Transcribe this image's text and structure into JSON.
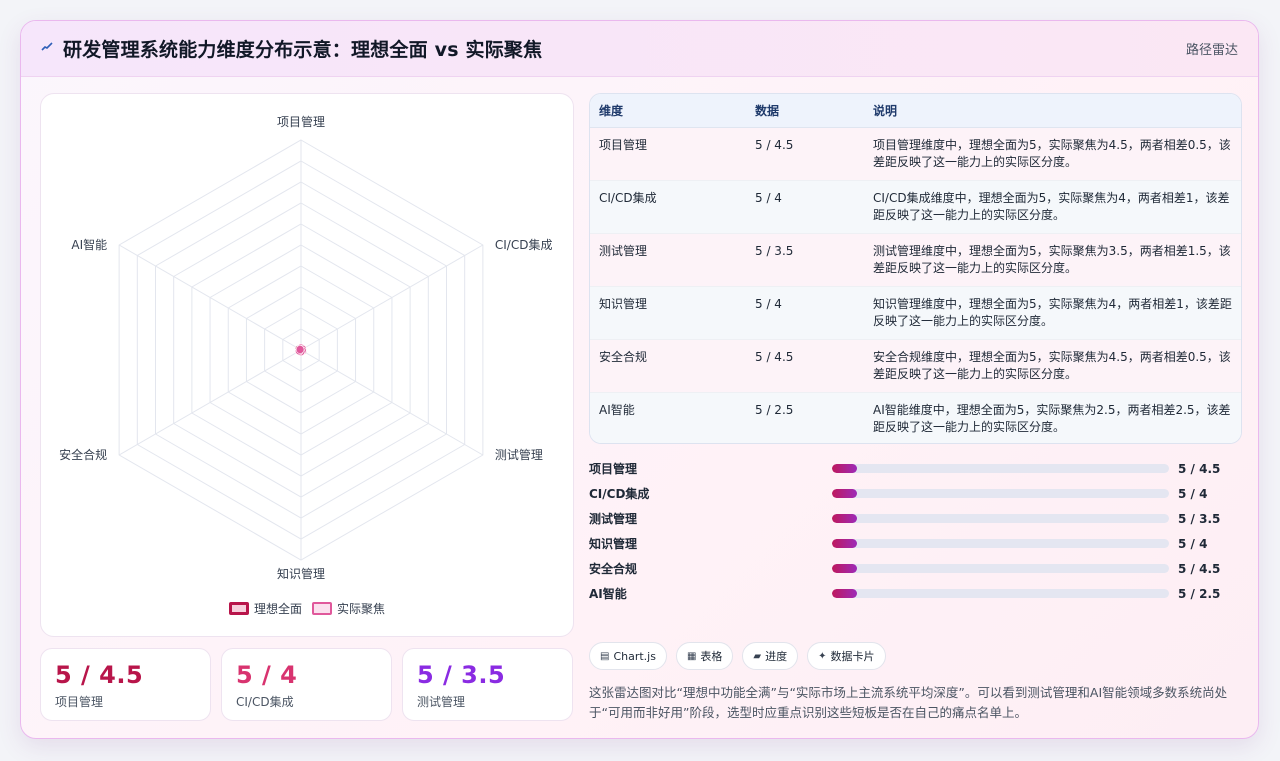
{
  "header": {
    "icon": "chart-line-icon",
    "title": "研发管理系统能力维度分布示意：理想全面 vs 实际聚焦",
    "right_label": "路径雷达"
  },
  "colors": {
    "ideal": "#b8154a",
    "actual": "#e0589b",
    "stat1": "#b8154a",
    "stat2": "#d8336f",
    "stat3": "#8a2be2"
  },
  "chart_data": {
    "type": "radar",
    "categories": [
      "项目管理",
      "CI/CD集成",
      "测试管理",
      "知识管理",
      "安全合规",
      "AI智能"
    ],
    "series": [
      {
        "name": "理想全面",
        "values": [
          5,
          5,
          5,
          5,
          5,
          5
        ]
      },
      {
        "name": "实际聚焦",
        "values": [
          4.5,
          4,
          3.5,
          4,
          4.5,
          2.5
        ]
      }
    ],
    "rlim": [
      0,
      500
    ],
    "ring_count": 10,
    "legend_position": "bottom"
  },
  "stats": [
    {
      "value": "5 / 4.5",
      "label": "项目管理"
    },
    {
      "value": "5 / 4",
      "label": "CI/CD集成"
    },
    {
      "value": "5 / 3.5",
      "label": "测试管理"
    }
  ],
  "table": {
    "headers": [
      "维度",
      "数据",
      "说明"
    ],
    "rows": [
      {
        "dim": "项目管理",
        "data": "5 / 4.5",
        "desc": "项目管理维度中，理想全面为5，实际聚焦为4.5，两者相差0.5，该差距反映了这一能力上的实际区分度。"
      },
      {
        "dim": "CI/CD集成",
        "data": "5 / 4",
        "desc": "CI/CD集成维度中，理想全面为5，实际聚焦为4，两者相差1，该差距反映了这一能力上的实际区分度。"
      },
      {
        "dim": "测试管理",
        "data": "5 / 3.5",
        "desc": "测试管理维度中，理想全面为5，实际聚焦为3.5，两者相差1.5，该差距反映了这一能力上的实际区分度。"
      },
      {
        "dim": "知识管理",
        "data": "5 / 4",
        "desc": "知识管理维度中，理想全面为5，实际聚焦为4，两者相差1，该差距反映了这一能力上的实际区分度。"
      },
      {
        "dim": "安全合规",
        "data": "5 / 4.5",
        "desc": "安全合规维度中，理想全面为5，实际聚焦为4.5，两者相差0.5，该差距反映了这一能力上的实际区分度。"
      },
      {
        "dim": "AI智能",
        "data": "5 / 2.5",
        "desc": "AI智能维度中，理想全面为5，实际聚焦为2.5，两者相差2.5，该差距反映了这一能力上的实际区分度。"
      }
    ]
  },
  "bars": [
    {
      "label": "项目管理",
      "value": "5 / 4.5",
      "fraction": 0.075
    },
    {
      "label": "CI/CD集成",
      "value": "5 / 4",
      "fraction": 0.075
    },
    {
      "label": "测试管理",
      "value": "5 / 3.5",
      "fraction": 0.075
    },
    {
      "label": "知识管理",
      "value": "5 / 4",
      "fraction": 0.075
    },
    {
      "label": "安全合规",
      "value": "5 / 4.5",
      "fraction": 0.075
    },
    {
      "label": "AI智能",
      "value": "5 / 2.5",
      "fraction": 0.075
    }
  ],
  "chips": [
    {
      "icon": "chart-icon",
      "glyph": "▤",
      "label": "Chart.js"
    },
    {
      "icon": "table-icon",
      "glyph": "▦",
      "label": "表格"
    },
    {
      "icon": "progress-icon",
      "glyph": "▰",
      "label": "进度"
    },
    {
      "icon": "card-icon",
      "glyph": "✦",
      "label": "数据卡片"
    }
  ],
  "note": "这张雷达图对比“理想中功能全满”与“实际市场上主流系统平均深度”。可以看到测试管理和AI智能领域多数系统尚处于“可用而非好用”阶段，选型时应重点识别这些短板是否在自己的痛点名单上。"
}
